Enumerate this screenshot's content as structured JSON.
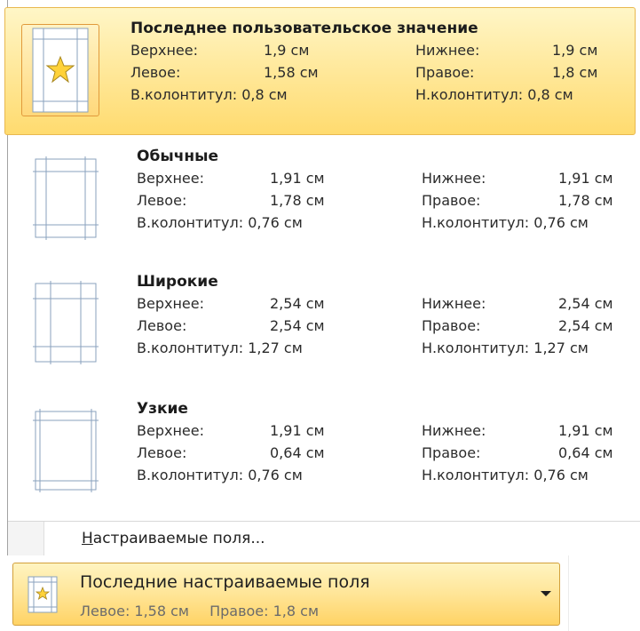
{
  "presets": [
    {
      "title": "Последнее пользовательское значение",
      "top_label": "Верхнее:",
      "top_value": "1,9 см",
      "bottom_label": "Нижнее:",
      "bottom_value": "1,9 см",
      "left_label": "Левое:",
      "left_value": "1,58 см",
      "right_label": "Правое:",
      "right_value": "1,8 см",
      "header_text": "В.колонтитул: 0,8 см",
      "footer_text": "Н.колонтитул: 0,8 см",
      "icon": "page-star-icon"
    },
    {
      "title": "Обычные",
      "top_label": "Верхнее:",
      "top_value": "1,91 см",
      "bottom_label": "Нижнее:",
      "bottom_value": "1,91 см",
      "left_label": "Левое:",
      "left_value": "1,78 см",
      "right_label": "Правое:",
      "right_value": "1,78 см",
      "header_text": "В.колонтитул: 0,76 см",
      "footer_text": "Н.колонтитул: 0,76 см",
      "icon": "page-normal-margins-icon"
    },
    {
      "title": "Широкие",
      "top_label": "Верхнее:",
      "top_value": "2,54 см",
      "bottom_label": "Нижнее:",
      "bottom_value": "2,54 см",
      "left_label": "Левое:",
      "left_value": "2,54 см",
      "right_label": "Правое:",
      "right_value": "2,54 см",
      "header_text": "В.колонтитул: 1,27 см",
      "footer_text": "Н.колонтитул: 1,27 см",
      "icon": "page-wide-margins-icon"
    },
    {
      "title": "Узкие",
      "top_label": "Верхнее:",
      "top_value": "1,91 см",
      "bottom_label": "Нижнее:",
      "bottom_value": "1,91 см",
      "left_label": "Левое:",
      "left_value": "0,64 см",
      "right_label": "Правое:",
      "right_value": "0,64 см",
      "header_text": "В.колонтитул: 0,76 см",
      "footer_text": "Н.колонтитул: 0,76 см",
      "icon": "page-narrow-margins-icon"
    }
  ],
  "custom_margins": {
    "accelerator": "Н",
    "rest": "астраиваемые поля..."
  },
  "bottom_button": {
    "title": "Последние настраиваемые поля",
    "left_text": "Левое: 1,58 см",
    "right_text": "Правое: 1,8 см",
    "icon": "page-star-icon"
  },
  "colors": {
    "highlight": "#ffe89a",
    "highlight_border": "#e9b84f",
    "guide_lines": "#8aa2bd"
  }
}
